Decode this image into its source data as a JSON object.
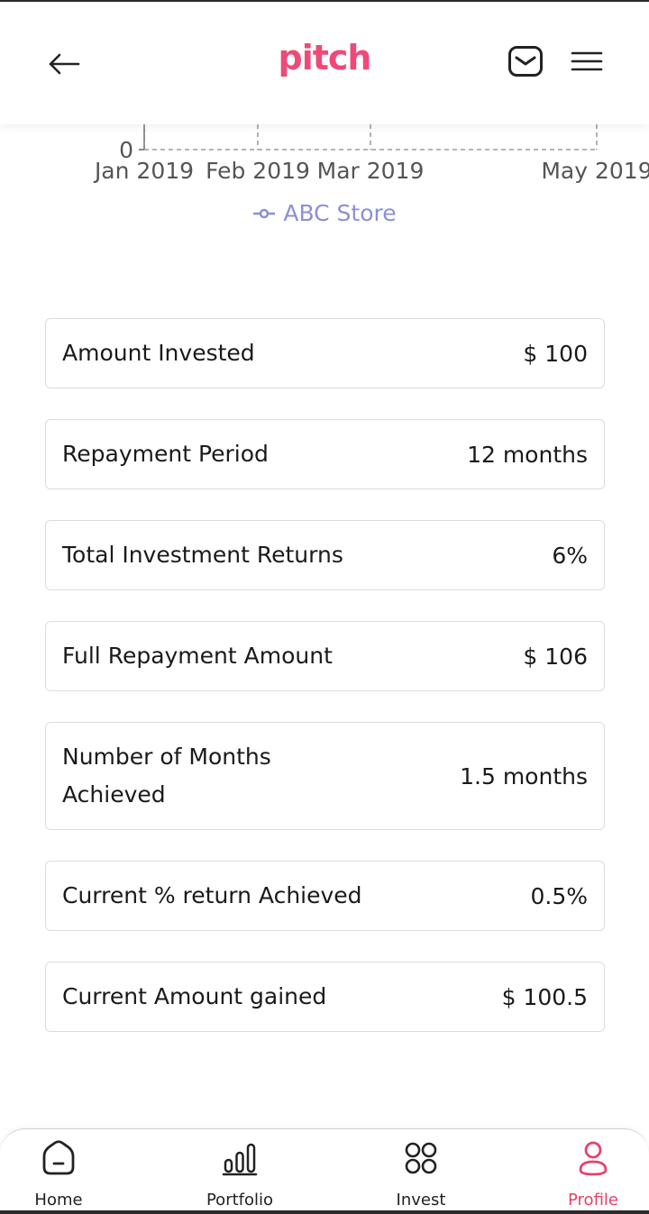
{
  "header": {
    "logo": "pitch",
    "logo_color": "#ee4a78"
  },
  "chart_data": {
    "type": "line",
    "y_ticks": [
      "0"
    ],
    "x_ticks": [
      "Jan 2019",
      "Feb 2019",
      "Mar 2019",
      "May 2019"
    ],
    "series": [
      {
        "name": "ABC Store",
        "values": []
      }
    ],
    "legend_color": "#8c8fd4"
  },
  "cards": [
    {
      "label": "Amount Invested",
      "value": "$ 100"
    },
    {
      "label": "Repayment Period",
      "value": "12 months"
    },
    {
      "label": "Total Investment Returns",
      "value": "6%"
    },
    {
      "label": "Full Repayment Amount",
      "value": "$ 106"
    },
    {
      "label": "Number of Months Achieved",
      "value": "1.5 months"
    },
    {
      "label": "Current % return Achieved",
      "value": "0.5%"
    },
    {
      "label": "Current Amount gained",
      "value": "$ 100.5"
    }
  ],
  "nav": {
    "home": "Home",
    "portfolio": "Portfolio",
    "invest": "Invest",
    "profile": "Profile",
    "active": "Profile",
    "active_color": "#e8416a"
  }
}
